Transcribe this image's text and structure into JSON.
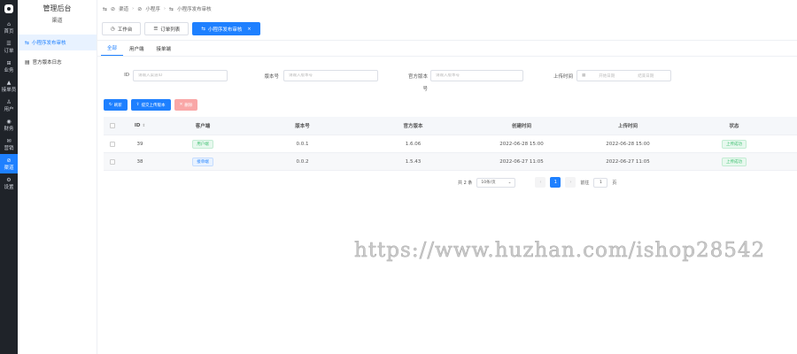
{
  "rail": {
    "items": [
      {
        "icon": "home-icon",
        "glyph": "⌂",
        "label": "首页"
      },
      {
        "icon": "order-icon",
        "glyph": "☰",
        "label": "订单"
      },
      {
        "icon": "business-icon",
        "glyph": "⊞",
        "label": "业务"
      },
      {
        "icon": "chart-icon",
        "glyph": "▲",
        "label": "接单员"
      },
      {
        "icon": "user-icon",
        "glyph": "♙",
        "label": "用户"
      },
      {
        "icon": "finance-icon",
        "glyph": "◉",
        "label": "财务"
      },
      {
        "icon": "marketing-icon",
        "glyph": "✉",
        "label": "营销"
      },
      {
        "icon": "channel-icon",
        "glyph": "⊘",
        "label": "渠道"
      },
      {
        "icon": "settings-icon",
        "glyph": "⚙",
        "label": "设置"
      }
    ],
    "active_index": 7
  },
  "sidebar": {
    "title": "管理后台",
    "subtitle": "渠道",
    "items": [
      {
        "label": "小程序发布审核",
        "glyph": "⇆"
      },
      {
        "label": "官方版本日志",
        "glyph": "▤"
      }
    ]
  },
  "topbar": {
    "crumbs": [
      "渠道",
      "小程序",
      "小程序发布审核"
    ]
  },
  "tabs": [
    {
      "label": "工作台",
      "glyph": "◷"
    },
    {
      "label": "订单列表",
      "glyph": "☰"
    },
    {
      "label": "小程序发布审核",
      "glyph": "⇆",
      "close": "×"
    }
  ],
  "subtabs": [
    "全部",
    "用户端",
    "接单端"
  ],
  "filters": {
    "id_label": "ID",
    "id_placeholder": "请输入渠道ID",
    "ver_label": "版本号",
    "ver_placeholder": "请输入版本号",
    "official_label": "官方版本",
    "official_label_2": "号",
    "official_placeholder": "请输入版本号",
    "upload_label": "上传时间",
    "start_placeholder": "开始日期",
    "end_placeholder": "结束日期"
  },
  "actions": {
    "refresh": "刷新",
    "upload": "提交上传版本",
    "delete": "删除"
  },
  "table": {
    "headers": {
      "id": "ID",
      "client": "客户端",
      "ver": "版本号",
      "official": "官方版本",
      "created": "创建时间",
      "upload": "上传时间",
      "status": "状态"
    },
    "rows": [
      {
        "id": "39",
        "client": "用户端",
        "client_color": "green",
        "ver": "0.0.1",
        "official": "1.6.06",
        "created": "2022-06-28 15:00",
        "upload": "2022-06-28 15:00",
        "status": "上传成功"
      },
      {
        "id": "38",
        "client": "接单端",
        "client_color": "blue",
        "ver": "0.0.2",
        "official": "1.5.43",
        "created": "2022-06-27 11:05",
        "upload": "2022-06-27 11:05",
        "status": "上传成功"
      }
    ]
  },
  "pager": {
    "total": "共 2 条",
    "size": "10条/页",
    "prev": "‹",
    "page": "1",
    "next": "›",
    "goto": "前往",
    "goto_value": "1",
    "unit": "页"
  },
  "watermark": "https://www.huzhan.com/ishop28542",
  "colors": {
    "rail": "#1f2329",
    "accent": "#1e80ff",
    "danger_light": "#f9a7a7",
    "success": "#3bbf6f"
  }
}
